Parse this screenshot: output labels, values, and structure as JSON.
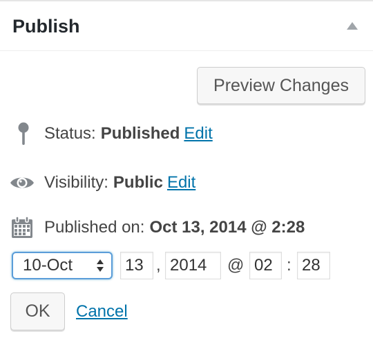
{
  "header": {
    "title": "Publish",
    "toggle_icon": "triangle-up-icon"
  },
  "actions": {
    "preview_label": "Preview Changes"
  },
  "status": {
    "icon": "pin-icon",
    "label": "Status:",
    "value": "Published",
    "edit_label": "Edit"
  },
  "visibility": {
    "icon": "eye-icon",
    "label": "Visibility:",
    "value": "Public",
    "edit_label": "Edit"
  },
  "published": {
    "icon": "calendar-icon",
    "label": "Published on:",
    "value": "Oct 13, 2014 @ 2:28"
  },
  "date_editor": {
    "month": "10-Oct",
    "day": "13",
    "comma": ",",
    "year": "2014",
    "at": "@",
    "hour": "02",
    "colon": ":",
    "minute": "28",
    "ok_label": "OK",
    "cancel_label": "Cancel"
  },
  "colors": {
    "link": "#0073aa",
    "focus_border": "#5b9dd9",
    "text": "#444444",
    "icon": "#82878c"
  }
}
